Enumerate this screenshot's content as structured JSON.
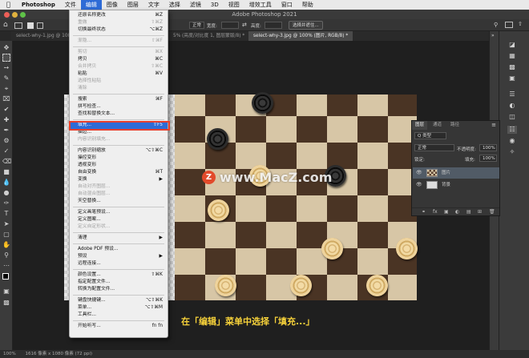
{
  "menubar": {
    "app": "Photoshop",
    "items": [
      "文件",
      "编辑",
      "图像",
      "图层",
      "文字",
      "选择",
      "滤镜",
      "3D",
      "视图",
      "增效工具",
      "窗口",
      "帮助"
    ]
  },
  "window_title": "Adobe Photoshop 2021",
  "options": {
    "mode_label": "正常",
    "width_label": "宽度:",
    "height_label": "高度:",
    "select_btn": "选择并遮住..."
  },
  "tabs": [
    {
      "label": "select-why-1.jpg @ 100% (RG...)"
    },
    {
      "label": "5% (亮度/对比度 1, 图层蒙版/8) *"
    },
    {
      "label": "select-why-3.jpg @ 100% (图片, RGB/8) *"
    }
  ],
  "edit_menu": {
    "items": [
      {
        "label": "还原名称更改",
        "shortcut": "⌘Z",
        "disabled": false
      },
      {
        "label": "重做",
        "shortcut": "⇧⌘Z",
        "disabled": true
      },
      {
        "label": "切换最终状态",
        "shortcut": "⌥⌘Z",
        "disabled": false
      },
      {
        "sep": true
      },
      {
        "label": "渐隐...",
        "shortcut": "⇧⌘F",
        "disabled": true
      },
      {
        "sep": true
      },
      {
        "label": "剪切",
        "shortcut": "⌘X",
        "disabled": true
      },
      {
        "label": "拷贝",
        "shortcut": "⌘C",
        "disabled": false
      },
      {
        "label": "合并拷贝",
        "shortcut": "⇧⌘C",
        "disabled": true
      },
      {
        "label": "粘贴",
        "shortcut": "⌘V",
        "disabled": false
      },
      {
        "label": "选择性粘贴",
        "shortcut": "",
        "disabled": true
      },
      {
        "label": "清除",
        "shortcut": "",
        "disabled": true
      },
      {
        "sep": true
      },
      {
        "label": "搜索",
        "shortcut": "⌘F",
        "disabled": false
      },
      {
        "label": "拼写检查...",
        "shortcut": "",
        "disabled": false
      },
      {
        "label": "查找和替换文本...",
        "shortcut": "",
        "disabled": false
      },
      {
        "sep": true
      },
      {
        "label": "填充...",
        "shortcut": "⇧F5",
        "disabled": false,
        "highlighted": true
      },
      {
        "label": "描边...",
        "shortcut": "",
        "disabled": false
      },
      {
        "label": "内容识别填充...",
        "shortcut": "",
        "disabled": true
      },
      {
        "sep": true
      },
      {
        "label": "内容识别缩放",
        "shortcut": "⌥⇧⌘C",
        "disabled": false
      },
      {
        "label": "操控变形",
        "shortcut": "",
        "disabled": false
      },
      {
        "label": "透视变形",
        "shortcut": "",
        "disabled": false
      },
      {
        "label": "自由变换",
        "shortcut": "⌘T",
        "disabled": false
      },
      {
        "label": "变换",
        "shortcut": "▶",
        "disabled": false
      },
      {
        "label": "自动对齐图层...",
        "shortcut": "",
        "disabled": true
      },
      {
        "label": "自动混合图层...",
        "shortcut": "",
        "disabled": true
      },
      {
        "label": "天空替换...",
        "shortcut": "",
        "disabled": false
      },
      {
        "sep": true
      },
      {
        "label": "定义画笔预设...",
        "shortcut": "",
        "disabled": false
      },
      {
        "label": "定义图案...",
        "shortcut": "",
        "disabled": false
      },
      {
        "label": "定义自定形状...",
        "shortcut": "",
        "disabled": true
      },
      {
        "sep": true
      },
      {
        "label": "清理",
        "shortcut": "▶",
        "disabled": false
      },
      {
        "sep": true
      },
      {
        "label": "Adobe PDF 预设...",
        "shortcut": "",
        "disabled": false
      },
      {
        "label": "预设",
        "shortcut": "▶",
        "disabled": false
      },
      {
        "label": "远程连接...",
        "shortcut": "",
        "disabled": false
      },
      {
        "sep": true
      },
      {
        "label": "颜色设置...",
        "shortcut": "⇧⌘K",
        "disabled": false
      },
      {
        "label": "指定配置文件...",
        "shortcut": "",
        "disabled": false
      },
      {
        "label": "转换为配置文件...",
        "shortcut": "",
        "disabled": false
      },
      {
        "sep": true
      },
      {
        "label": "键盘快捷键...",
        "shortcut": "⌥⇧⌘K",
        "disabled": false
      },
      {
        "label": "菜单...",
        "shortcut": "⌥⇧⌘M",
        "disabled": false
      },
      {
        "label": "工具栏...",
        "shortcut": "",
        "disabled": false
      },
      {
        "sep": true
      },
      {
        "label": "开始听写...",
        "shortcut": "fn fn",
        "disabled": false
      }
    ]
  },
  "layers_panel": {
    "tabs": [
      "图层",
      "通道",
      "路径"
    ],
    "kind_label": "Q 类型",
    "blend_mode": "正常",
    "opacity_label": "不透明度:",
    "opacity_value": "100%",
    "lock_label": "锁定:",
    "fill_label": "填充:",
    "fill_value": "100%",
    "layers": [
      {
        "name": "图片",
        "selected": true
      },
      {
        "name": "背景",
        "selected": false
      }
    ]
  },
  "watermark": "www.MacZ.com",
  "watermark_logo": "Z",
  "caption": "在「编辑」菜单中选择「填充...」",
  "status": {
    "zoom": "100%",
    "doc_info": "1616 像素 x 1080 像素 (72 ppi)"
  },
  "colors": {
    "menu_highlight": "#2e6bd6",
    "annotation_box": "#e8402c",
    "caption": "#f7d23a"
  }
}
